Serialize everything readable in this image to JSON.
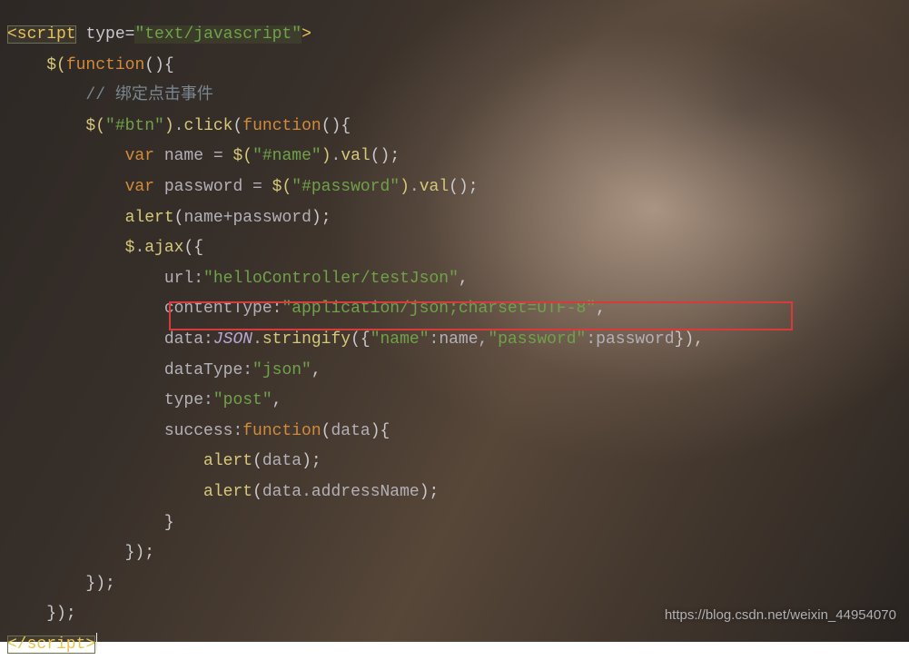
{
  "code": {
    "lines": [
      {
        "indent": 0,
        "segs": [
          {
            "c": "t-tag hl-tag",
            "t": "<script"
          },
          {
            "c": "t-id",
            "t": " "
          },
          {
            "c": "t-attr",
            "t": "type="
          },
          {
            "c": "t-str hl-str",
            "t": "\"text/javascript\""
          },
          {
            "c": "t-tag",
            "t": ">"
          }
        ]
      },
      {
        "indent": 1,
        "segs": [
          {
            "c": "t-jq",
            "t": "$("
          },
          {
            "c": "t-kw",
            "t": "function"
          },
          {
            "c": "t-brace",
            "t": "(){"
          }
        ]
      },
      {
        "indent": 2,
        "segs": [
          {
            "c": "t-cmt",
            "t": "// 绑定点击事件"
          }
        ]
      },
      {
        "indent": 2,
        "segs": [
          {
            "c": "t-jq",
            "t": "$("
          },
          {
            "c": "t-str",
            "t": "\"#btn\""
          },
          {
            "c": "t-jq",
            "t": ")"
          },
          {
            "c": "t-id",
            "t": "."
          },
          {
            "c": "t-fn",
            "t": "click"
          },
          {
            "c": "t-brace",
            "t": "("
          },
          {
            "c": "t-kw",
            "t": "function"
          },
          {
            "c": "t-brace",
            "t": "(){"
          }
        ]
      },
      {
        "indent": 3,
        "segs": [
          {
            "c": "t-kw",
            "t": "var"
          },
          {
            "c": "t-id",
            "t": " name = "
          },
          {
            "c": "t-jq",
            "t": "$("
          },
          {
            "c": "t-str",
            "t": "\"#name\""
          },
          {
            "c": "t-jq",
            "t": ")"
          },
          {
            "c": "t-id",
            "t": "."
          },
          {
            "c": "t-fn",
            "t": "val"
          },
          {
            "c": "t-brace",
            "t": "();"
          }
        ]
      },
      {
        "indent": 3,
        "segs": [
          {
            "c": "t-kw",
            "t": "var"
          },
          {
            "c": "t-id",
            "t": " password = "
          },
          {
            "c": "t-jq",
            "t": "$("
          },
          {
            "c": "t-str",
            "t": "\"#password\""
          },
          {
            "c": "t-jq",
            "t": ")"
          },
          {
            "c": "t-id",
            "t": "."
          },
          {
            "c": "t-fn",
            "t": "val"
          },
          {
            "c": "t-brace",
            "t": "();"
          }
        ]
      },
      {
        "indent": 3,
        "segs": [
          {
            "c": "t-fn",
            "t": "alert"
          },
          {
            "c": "t-brace",
            "t": "("
          },
          {
            "c": "t-id",
            "t": "name+password"
          },
          {
            "c": "t-brace",
            "t": ");"
          }
        ]
      },
      {
        "indent": 3,
        "segs": [
          {
            "c": "t-jq",
            "t": "$"
          },
          {
            "c": "t-id",
            "t": "."
          },
          {
            "c": "t-fn",
            "t": "ajax"
          },
          {
            "c": "t-brace",
            "t": "({"
          }
        ]
      },
      {
        "indent": 4,
        "segs": [
          {
            "c": "t-id",
            "t": "url:"
          },
          {
            "c": "t-str",
            "t": "\"helloController/testJson\""
          },
          {
            "c": "t-brace",
            "t": ","
          }
        ]
      },
      {
        "indent": 4,
        "segs": [
          {
            "c": "t-id",
            "t": "contentType:"
          },
          {
            "c": "t-str",
            "t": "\"application/json;charset=UTF-8\""
          },
          {
            "c": "t-brace",
            "t": ","
          }
        ]
      },
      {
        "indent": 4,
        "segs": [
          {
            "c": "t-id",
            "t": "data:"
          },
          {
            "c": "t-json",
            "t": "JSON"
          },
          {
            "c": "t-id",
            "t": "."
          },
          {
            "c": "t-fn",
            "t": "stringify"
          },
          {
            "c": "t-brace",
            "t": "({"
          },
          {
            "c": "t-str",
            "t": "\"name\""
          },
          {
            "c": "t-id",
            "t": ":name,"
          },
          {
            "c": "t-str",
            "t": "\"password\""
          },
          {
            "c": "t-id",
            "t": ":password"
          },
          {
            "c": "t-brace",
            "t": "}),"
          }
        ]
      },
      {
        "indent": 4,
        "segs": [
          {
            "c": "t-id",
            "t": "dataType:"
          },
          {
            "c": "t-str",
            "t": "\"json\""
          },
          {
            "c": "t-brace",
            "t": ","
          }
        ]
      },
      {
        "indent": 4,
        "segs": [
          {
            "c": "t-id",
            "t": "type:"
          },
          {
            "c": "t-str",
            "t": "\"post\""
          },
          {
            "c": "t-brace",
            "t": ","
          }
        ]
      },
      {
        "indent": 4,
        "segs": [
          {
            "c": "t-id",
            "t": "success:"
          },
          {
            "c": "t-kw",
            "t": "function"
          },
          {
            "c": "t-brace",
            "t": "("
          },
          {
            "c": "t-id",
            "t": "data"
          },
          {
            "c": "t-brace",
            "t": "){"
          }
        ]
      },
      {
        "indent": 5,
        "segs": [
          {
            "c": "t-fn",
            "t": "alert"
          },
          {
            "c": "t-brace",
            "t": "("
          },
          {
            "c": "t-id",
            "t": "data"
          },
          {
            "c": "t-brace",
            "t": ");"
          }
        ]
      },
      {
        "indent": 5,
        "segs": [
          {
            "c": "t-fn",
            "t": "alert"
          },
          {
            "c": "t-brace",
            "t": "("
          },
          {
            "c": "t-id",
            "t": "data.addressName"
          },
          {
            "c": "t-brace",
            "t": ");"
          }
        ]
      },
      {
        "indent": 4,
        "segs": [
          {
            "c": "t-brace",
            "t": "}"
          }
        ]
      },
      {
        "indent": 3,
        "segs": [
          {
            "c": "t-brace",
            "t": "});"
          }
        ]
      },
      {
        "indent": 2,
        "segs": [
          {
            "c": "t-brace",
            "t": "});"
          }
        ]
      },
      {
        "indent": 1,
        "segs": [
          {
            "c": "t-brace",
            "t": "});"
          }
        ]
      },
      {
        "indent": 0,
        "segs": [
          {
            "c": "t-tag hl-tag",
            "t": "</script>"
          }
        ],
        "cursor": true
      }
    ],
    "indentUnit": "    "
  },
  "watermark": "https://blog.csdn.net/weixin_44954070"
}
